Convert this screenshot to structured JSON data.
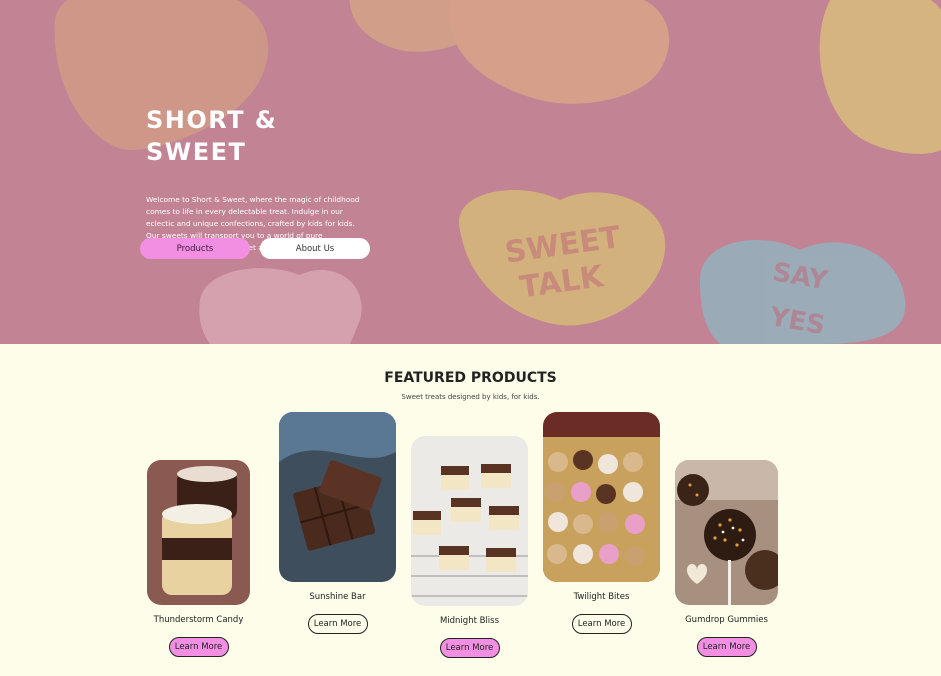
{
  "hero": {
    "title": "SHORT & SWEET",
    "description": "Welcome to Short & Sweet, where the magic of childhood comes to life in every delectable treat. Indulge in our eclectic and unique confections, crafted by kids for kids. Our sweets will transport you to a world of pure imagination. Start your sweet adventure today!",
    "products_button": "Products",
    "about_button": "About Us"
  },
  "featured": {
    "title": "FEATURED PRODUCTS",
    "subtitle": "Sweet treats designed by kids, for kids.",
    "products": [
      {
        "name": "Thunderstorm Candy",
        "button": "Learn More"
      },
      {
        "name": "Sunshine Bar",
        "button": "Learn More"
      },
      {
        "name": "Midnight Bliss",
        "button": "Learn More"
      },
      {
        "name": "Twilight Bites",
        "button": "Learn More"
      },
      {
        "name": "Gumdrop Gummies",
        "button": "Learn More"
      }
    ]
  },
  "colors": {
    "accent_pink": "#f28fe2",
    "background": "#fdfdea",
    "hero_overlay": "#c98a9c"
  }
}
